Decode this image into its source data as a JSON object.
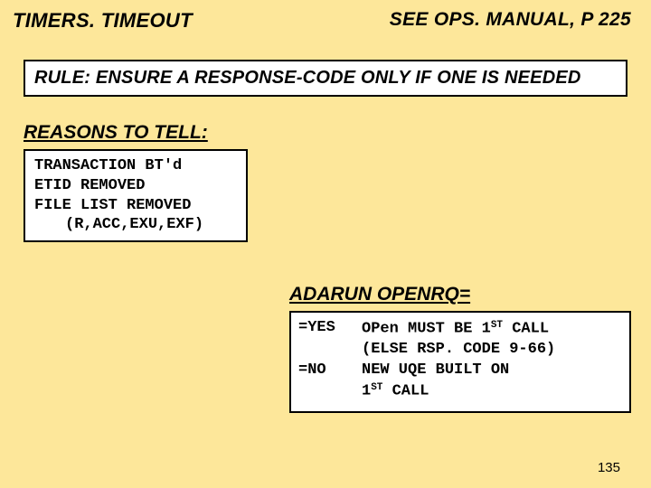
{
  "header": {
    "title": "TIMERS. TIMEOUT",
    "reference": "SEE OPS. MANUAL, P 225"
  },
  "rule": {
    "text": "RULE: ENSURE A RESPONSE-CODE ONLY IF ONE IS NEEDED"
  },
  "reasons": {
    "heading": "REASONS TO TELL:",
    "lines": [
      "TRANSACTION BT'd",
      "ETID REMOVED",
      "FILE LIST REMOVED",
      "(R,ACC,EXU,EXF)"
    ]
  },
  "adarun": {
    "heading": "ADARUN OPENRQ=",
    "rows": [
      {
        "key": "=YES",
        "val_a": "OPen MUST BE 1",
        "val_b": " CALL"
      },
      {
        "key": "",
        "val_a": "(ELSE RSP. CODE 9-66)",
        "val_b": ""
      },
      {
        "key": "=NO",
        "val_a": "NEW UQE BUILT ON",
        "val_b": ""
      },
      {
        "key": "",
        "val_a": "1",
        "val_b": " CALL"
      }
    ],
    "sup": "ST"
  },
  "page": "135"
}
